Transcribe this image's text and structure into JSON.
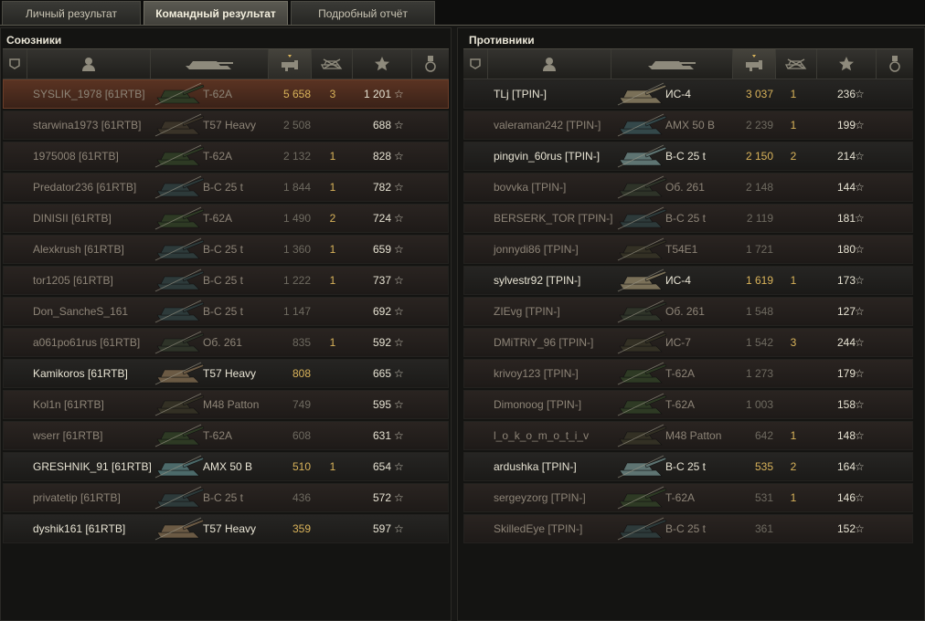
{
  "tabs": [
    {
      "label": "Личный результат",
      "active": false
    },
    {
      "label": "Командный результат",
      "active": true
    },
    {
      "label": "Подробный отчёт",
      "active": false
    }
  ],
  "allies": {
    "title": "Союзники",
    "rows": [
      {
        "player": "SYSLIK_1978 [61RTB]",
        "vehicle": "T-62A",
        "damage": "5 658",
        "kills": "3",
        "xp": "1 201",
        "state": "me",
        "tank_color": "#2e3a24"
      },
      {
        "player": "starwina1973 [61RTB]",
        "vehicle": "T57 Heavy",
        "damage": "2 508",
        "kills": "",
        "xp": "688",
        "state": "dead",
        "tank_color": "#3a3328"
      },
      {
        "player": "1975008 [61RTB]",
        "vehicle": "T-62A",
        "damage": "2 132",
        "kills": "1",
        "xp": "828",
        "state": "dead",
        "tank_color": "#2e3a24"
      },
      {
        "player": "Predator236 [61RTB]",
        "vehicle": "B-C 25 t",
        "damage": "1 844",
        "kills": "1",
        "xp": "782",
        "state": "dead",
        "tank_color": "#2d3a3a"
      },
      {
        "player": "DINISII [61RTB]",
        "vehicle": "T-62A",
        "damage": "1 490",
        "kills": "2",
        "xp": "724",
        "state": "dead",
        "tank_color": "#2e3a24"
      },
      {
        "player": "Alexkrush [61RTB]",
        "vehicle": "B-C 25 t",
        "damage": "1 360",
        "kills": "1",
        "xp": "659",
        "state": "dead",
        "tank_color": "#2d3a3a"
      },
      {
        "player": "tor1205 [61RTB]",
        "vehicle": "B-C 25 t",
        "damage": "1 222",
        "kills": "1",
        "xp": "737",
        "state": "dead",
        "tank_color": "#2d3a3a"
      },
      {
        "player": "Don_SancheS_161",
        "vehicle": "B-C 25 t",
        "damage": "1 147",
        "kills": "",
        "xp": "692",
        "state": "dead",
        "tank_color": "#2d3a3a"
      },
      {
        "player": "a061po61rus [61RTB]",
        "vehicle": "Об. 261",
        "damage": "835",
        "kills": "1",
        "xp": "592",
        "state": "dead",
        "tank_color": "#2e3328"
      },
      {
        "player": "Kamikoros [61RTB]",
        "vehicle": "T57 Heavy",
        "damage": "808",
        "kills": "",
        "xp": "665",
        "state": "alive",
        "tank_color": "#6b5a44"
      },
      {
        "player": "Kol1n [61RTB]",
        "vehicle": "M48 Patton",
        "damage": "749",
        "kills": "",
        "xp": "595",
        "state": "dead",
        "tank_color": "#333024"
      },
      {
        "player": "wserr [61RTB]",
        "vehicle": "T-62A",
        "damage": "608",
        "kills": "",
        "xp": "631",
        "state": "dead",
        "tank_color": "#2e3a24"
      },
      {
        "player": "GRESHNIK_91 [61RTB]",
        "vehicle": "AMX 50 B",
        "damage": "510",
        "kills": "1",
        "xp": "654",
        "state": "alive",
        "tank_color": "#4c6a6a"
      },
      {
        "player": "privatetip [61RTB]",
        "vehicle": "B-C 25 t",
        "damage": "436",
        "kills": "",
        "xp": "572",
        "state": "dead",
        "tank_color": "#2d3a3a"
      },
      {
        "player": "dyshik161 [61RTB]",
        "vehicle": "T57 Heavy",
        "damage": "359",
        "kills": "",
        "xp": "597",
        "state": "alive",
        "tank_color": "#6b5a44"
      }
    ]
  },
  "enemies": {
    "title": "Противники",
    "rows": [
      {
        "player": "TLj [TPIN-]",
        "vehicle": "ИС-4",
        "damage": "3 037",
        "kills": "1",
        "xp": "236",
        "state": "alive",
        "tank_color": "#7a7058"
      },
      {
        "player": "valeraman242 [TPIN-]",
        "vehicle": "AMX 50 B",
        "damage": "2 239",
        "kills": "1",
        "xp": "199",
        "state": "dead",
        "tank_color": "#34484a"
      },
      {
        "player": "pingvin_60rus [TPIN-]",
        "vehicle": "B-C 25 t",
        "damage": "2 150",
        "kills": "2",
        "xp": "214",
        "state": "alive",
        "tank_color": "#5e7472"
      },
      {
        "player": "bovvka [TPIN-]",
        "vehicle": "Об. 261",
        "damage": "2 148",
        "kills": "",
        "xp": "144",
        "state": "dead",
        "tank_color": "#2e3328"
      },
      {
        "player": "BERSERK_TOR [TPIN-]",
        "vehicle": "B-C 25 t",
        "damage": "2 119",
        "kills": "",
        "xp": "181",
        "state": "dead",
        "tank_color": "#2d3a3a"
      },
      {
        "player": "jonnydi86 [TPIN-]",
        "vehicle": "T54E1",
        "damage": "1 721",
        "kills": "",
        "xp": "180",
        "state": "dead",
        "tank_color": "#333024"
      },
      {
        "player": "sylvestr92 [TPIN-]",
        "vehicle": "ИС-4",
        "damage": "1 619",
        "kills": "1",
        "xp": "173",
        "state": "alive",
        "tank_color": "#7a7058"
      },
      {
        "player": "ZIEvg [TPIN-]",
        "vehicle": "Об. 261",
        "damage": "1 548",
        "kills": "",
        "xp": "127",
        "state": "dead",
        "tank_color": "#2e3328"
      },
      {
        "player": "DMiTRiY_96 [TPIN-]",
        "vehicle": "ИС-7",
        "damage": "1 542",
        "kills": "3",
        "xp": "244",
        "state": "dead",
        "tank_color": "#333024"
      },
      {
        "player": "krivoy123 [TPIN-]",
        "vehicle": "T-62A",
        "damage": "1 273",
        "kills": "",
        "xp": "179",
        "state": "dead",
        "tank_color": "#2e3a24"
      },
      {
        "player": "Dimonoog [TPIN-]",
        "vehicle": "T-62A",
        "damage": "1 003",
        "kills": "",
        "xp": "158",
        "state": "dead",
        "tank_color": "#2e3a24"
      },
      {
        "player": "l_o_k_o_m_o_t_i_v",
        "vehicle": "M48 Patton",
        "damage": "642",
        "kills": "1",
        "xp": "148",
        "state": "dead",
        "tank_color": "#333024"
      },
      {
        "player": "ardushka [TPIN-]",
        "vehicle": "B-C 25 t",
        "damage": "535",
        "kills": "2",
        "xp": "164",
        "state": "alive",
        "tank_color": "#5e7472"
      },
      {
        "player": "sergeyzorg [TPIN-]",
        "vehicle": "T-62A",
        "damage": "531",
        "kills": "1",
        "xp": "146",
        "state": "dead",
        "tank_color": "#2e3a24"
      },
      {
        "player": "SkilledEye [TPIN-]",
        "vehicle": "B-C 25 t",
        "damage": "361",
        "kills": "",
        "xp": "152",
        "state": "dead",
        "tank_color": "#2d3a3a"
      }
    ]
  },
  "xp_star_glyph": "☆",
  "header_icons": [
    "squad-icon",
    "player-icon",
    "tank-icon",
    "damage-icon",
    "kills-icon",
    "xp-star-icon",
    "medal-icon"
  ]
}
